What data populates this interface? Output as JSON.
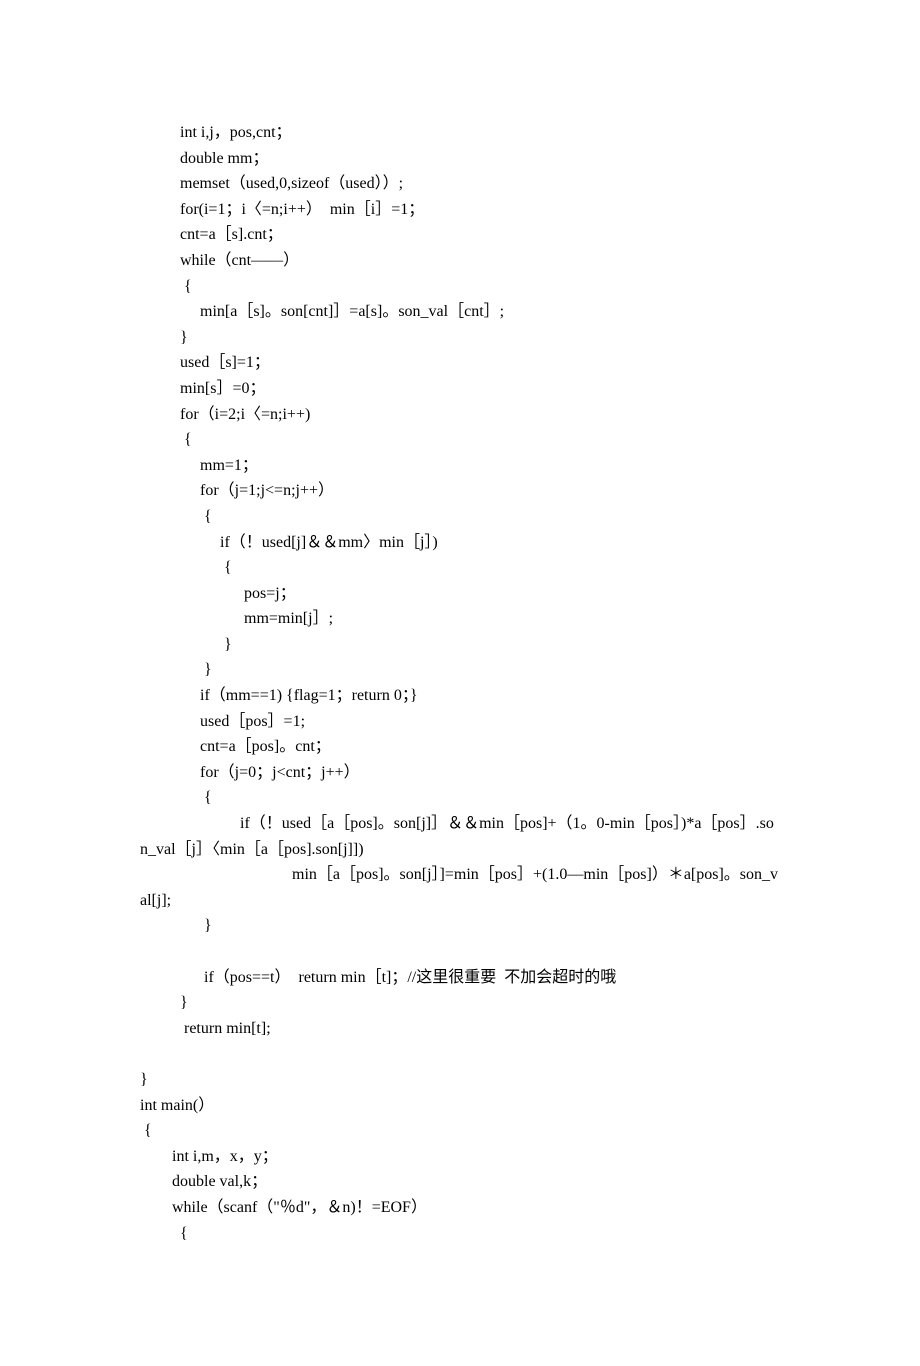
{
  "code_lines": [
    "          int i,j，pos,cnt；",
    "          double mm；",
    "          memset（used,0,sizeof（used））;",
    "          for(i=1；i〈=n;i++）  min［i］=1；",
    "          cnt=a［s].cnt；",
    "          while（cnt——）",
    "           {",
    "               min[a［s]。son[cnt]］=a[s]。son_val［cnt］;",
    "          }",
    "          used［s]=1；",
    "          min[s］=0；",
    "          for（i=2;i〈=n;i++)",
    "           {",
    "               mm=1；",
    "               for（j=1;j<=n;j++）",
    "                {",
    "                    if（！used[j]＆＆mm〉min［j］)",
    "                     {",
    "                          pos=j；",
    "                          mm=min[j］;",
    "                     }",
    "                }",
    "               if（mm==1) {flag=1；return 0；}",
    "               used［pos］=1;",
    "               cnt=a［pos]。cnt；",
    "               for（j=0；j<cnt；j++）",
    "                {",
    "                         if（！used［a［pos]。son[j]］＆＆min［pos]+（1。0-min［pos］)*a［pos］.son_val［j］〈min［a［pos].son[j]])",
    "                                      min［a［pos]。son[j］]=min［pos］+(1.0—min［pos]）＊a[pos]。son_val[j];",
    "                }",
    "",
    "                if（pos==t）  return min［t]；//这里很重要  不加会超时的哦",
    "          }",
    "           return min[t];",
    "",
    "}",
    "int main(）",
    " {",
    "        int i,m，x，y；",
    "        double val,k；",
    "        while（scanf（\"％d\"，＆n)！=EOF）",
    "          {"
  ]
}
